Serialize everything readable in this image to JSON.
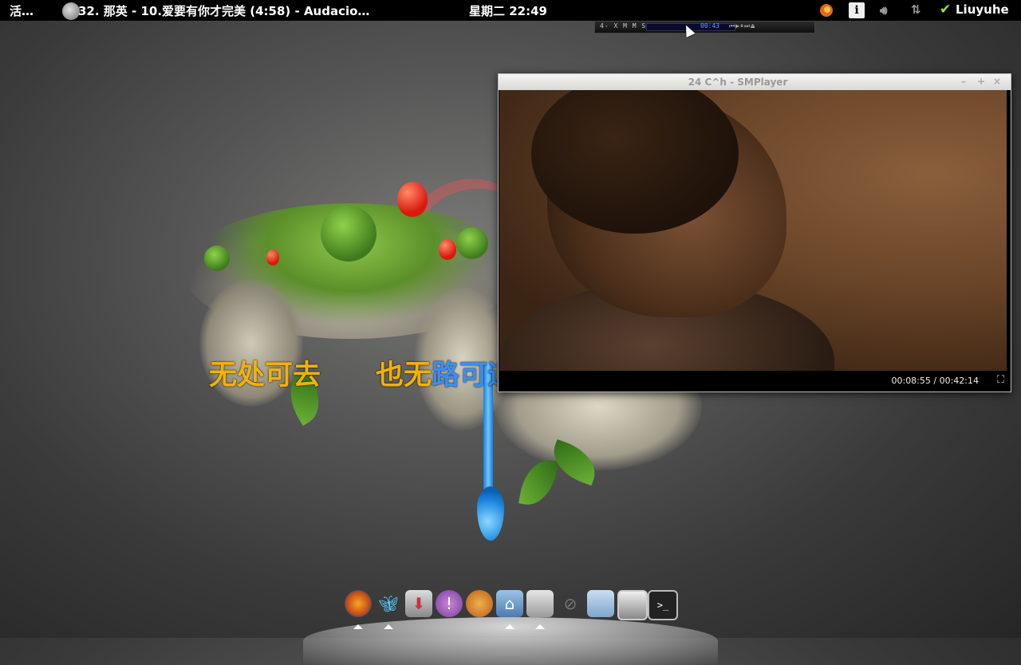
{
  "top_panel": {
    "activities": "活…",
    "app_title": "32. 那英 - 10.爱要有你才完美 (4:58) - Audacio…",
    "clock": "星期二 22:49",
    "user": "Liuyuhe",
    "info_icon_label": "i",
    "icons": [
      "audacious-app-icon",
      "firefox-tray-icon",
      "info-icon",
      "volume-icon",
      "network-icon",
      "check-icon"
    ]
  },
  "mini_player": {
    "label": "4- X M M S",
    "time": "00:43"
  },
  "lyrics": {
    "part1": "无处可去",
    "part2_a": "也无",
    "part2_b": "路可退"
  },
  "smplayer": {
    "title": "24 C^h - SMPlayer",
    "time": "00:08:55 / 00:42:14",
    "window_buttons": [
      "–",
      "+",
      "×"
    ]
  },
  "dock": {
    "items": [
      "firefox-icon",
      "butterfly-icon",
      "download-icon",
      "empathy-icon",
      "paint-icon",
      "home-folder-icon",
      "settings-icon",
      "link-icon",
      "folder-icon",
      "screen-icon",
      "terminal-icon"
    ]
  },
  "colors": {
    "lyric_gold": "#f2b10a",
    "lyric_blue": "#3b8ef0",
    "panel_bg": "#000000"
  }
}
